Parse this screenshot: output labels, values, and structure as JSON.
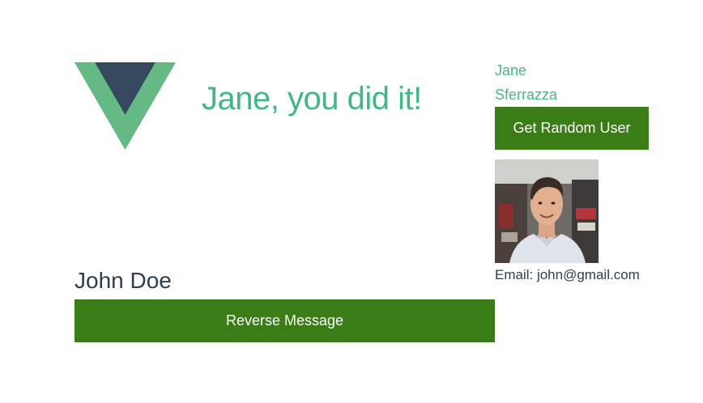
{
  "header": {
    "logo_icon": "vue-logo-icon",
    "message": "Jane, you did it!"
  },
  "user_panel": {
    "first_name": "Jane",
    "last_name": "Sferrazza",
    "random_button_label": "Get Random User",
    "avatar_alt": "avatar",
    "email_label": "Email: john@gmail.com"
  },
  "person": {
    "name": "John Doe",
    "reverse_button_label": "Reverse Message"
  },
  "colors": {
    "accent_green": "#41b883",
    "dark_slate": "#35495e",
    "button_green": "#3a7c16",
    "text_dark": "#2c3e50"
  }
}
